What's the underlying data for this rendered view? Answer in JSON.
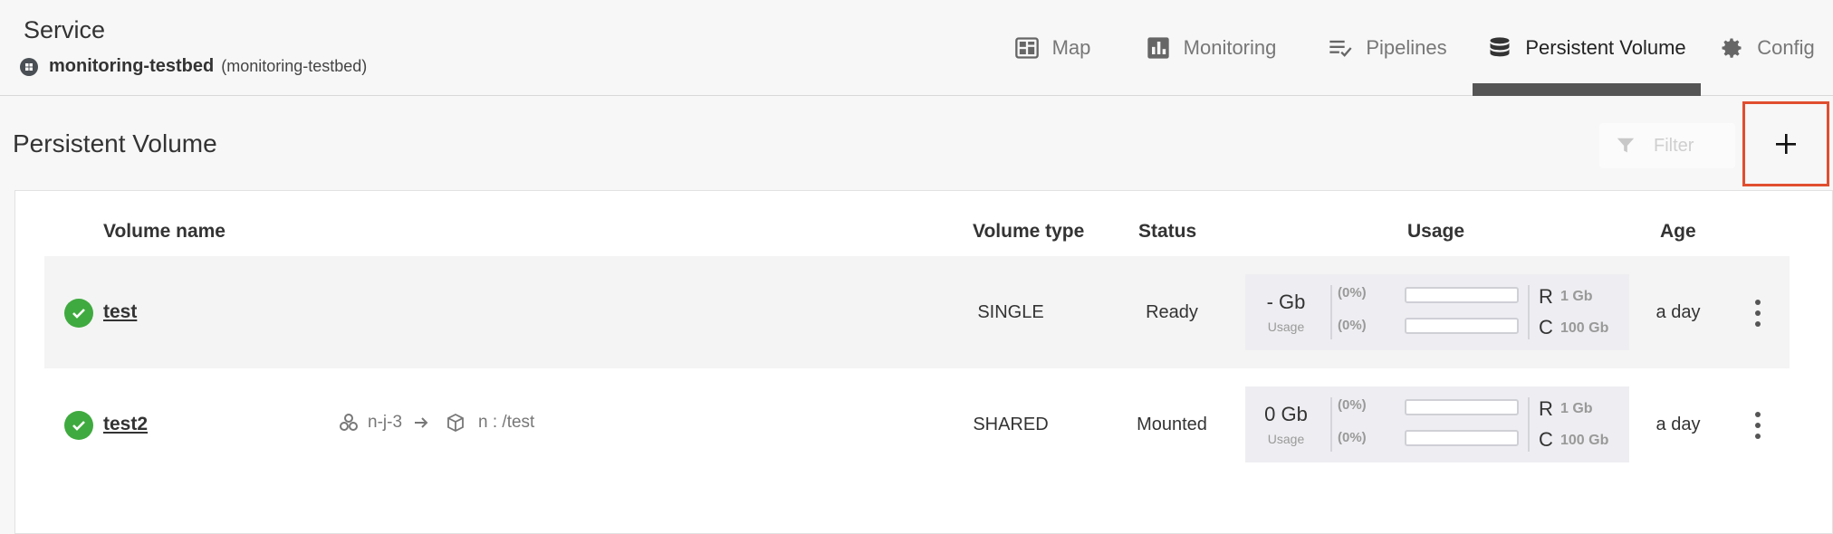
{
  "header": {
    "title": "Service",
    "service_name": "monitoring-testbed",
    "service_paren": "(monitoring-testbed)"
  },
  "tabs": [
    {
      "label": "Map",
      "icon": "map-icon",
      "active": false
    },
    {
      "label": "Monitoring",
      "icon": "bar-chart-icon",
      "active": false
    },
    {
      "label": "Pipelines",
      "icon": "pipelines-icon",
      "active": false
    },
    {
      "label": "Persistent Volume",
      "icon": "database-icon",
      "active": true
    },
    {
      "label": "Config",
      "icon": "gear-icon",
      "active": false
    }
  ],
  "page": {
    "title": "Persistent Volume",
    "filter_placeholder": "Filter",
    "add_label": "+"
  },
  "table": {
    "headers": [
      "Volume name",
      "Volume type",
      "Status",
      "Usage",
      "Age"
    ],
    "rows": [
      {
        "name": "test",
        "mount_source": "",
        "mount_target": "",
        "type": "SINGLE",
        "status": "Ready",
        "usage_value": "- Gb",
        "usage_label": "Usage",
        "r_pct": "(0%)",
        "c_pct": "(0%)",
        "r_label": "R",
        "r_value": "1 Gb",
        "c_label": "C",
        "c_value": "100 Gb",
        "age": "a day"
      },
      {
        "name": "test2",
        "mount_source": "n-j-3",
        "mount_target": "n : /test",
        "type": "SHARED",
        "status": "Mounted",
        "usage_value": "0 Gb",
        "usage_label": "Usage",
        "r_pct": "(0%)",
        "c_pct": "(0%)",
        "r_label": "R",
        "r_value": "1 Gb",
        "c_label": "C",
        "c_value": "100 Gb",
        "age": "a day"
      }
    ]
  },
  "colors": {
    "accent_border": "#e04e2f",
    "status_ok": "#3faa3f",
    "active_tab_bar": "#555555"
  }
}
